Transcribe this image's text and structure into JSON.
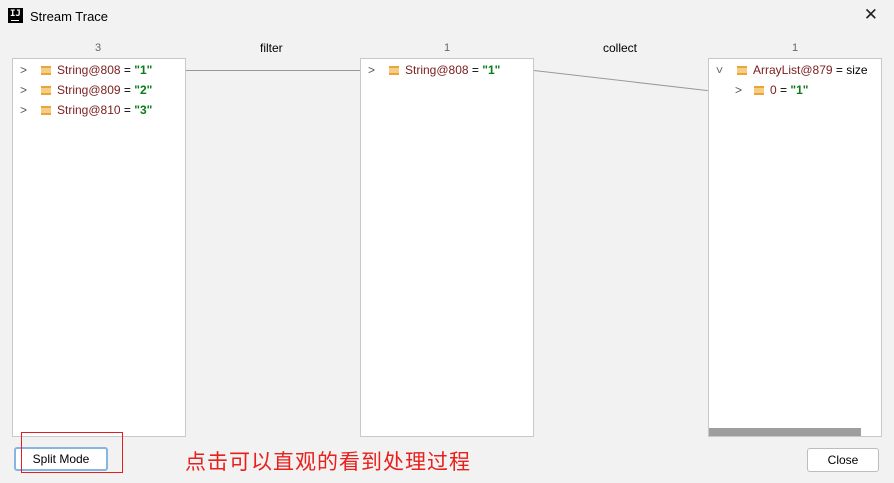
{
  "window": {
    "title": "Stream Trace",
    "close_glyph": "✕"
  },
  "stages": [
    {
      "count": "3",
      "items": [
        {
          "name": "String@808",
          "eq": " = ",
          "value": "\"1\""
        },
        {
          "name": "String@809",
          "eq": " = ",
          "value": "\"2\""
        },
        {
          "name": "String@810",
          "eq": " = ",
          "value": "\"3\""
        }
      ]
    },
    {
      "count": "1",
      "items": [
        {
          "name": "String@808",
          "eq": " = ",
          "value": "\"1\""
        }
      ]
    },
    {
      "count": "1",
      "items": [
        {
          "name": "ArrayList@879",
          "eq": " = ",
          "value": " size"
        },
        {
          "name": "0",
          "eq": " = ",
          "value": "\"1\""
        }
      ]
    }
  ],
  "operations": [
    "filter",
    "collect"
  ],
  "icons": {
    "collapsed": "chevron-right-icon",
    "expanded": "chevron-down-icon",
    "field": "field-icon"
  },
  "buttons": {
    "split_mode": "Split Mode",
    "close": "Close"
  },
  "annotation": "点击可以直观的看到处理过程",
  "colors": {
    "annotation": "#e8201c",
    "value": "#067d17",
    "name": "#7a1d1d",
    "focus_border": "#87b4e1"
  }
}
